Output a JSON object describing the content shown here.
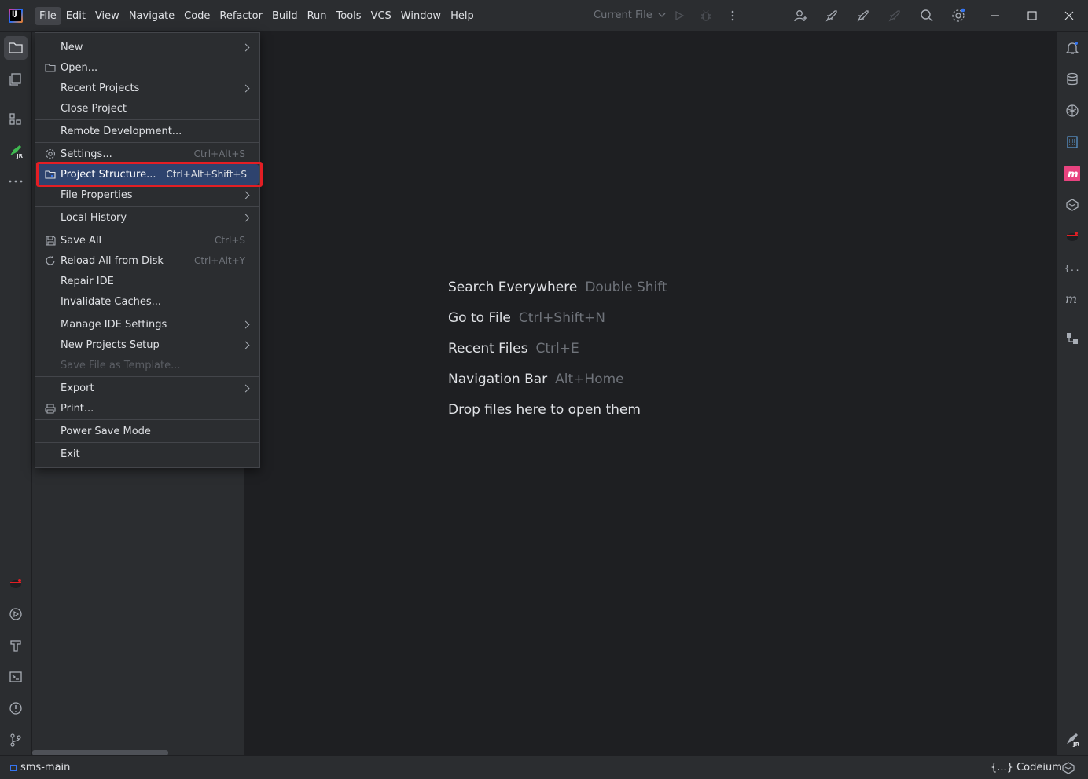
{
  "title_bar": {
    "logo_text": "IJ",
    "menus": [
      "File",
      "Edit",
      "View",
      "Navigate",
      "Code",
      "Refactor",
      "Build",
      "Run",
      "Tools",
      "VCS",
      "Window",
      "Help"
    ],
    "run_config": "Current File"
  },
  "file_menu": {
    "items": [
      {
        "label": "New",
        "shortcut": "",
        "submenu": true,
        "icon": ""
      },
      {
        "label": "Open...",
        "shortcut": "",
        "submenu": false,
        "icon": "folder-icon"
      },
      {
        "label": "Recent Projects",
        "shortcut": "",
        "submenu": true,
        "icon": ""
      },
      {
        "label": "Close Project",
        "shortcut": "",
        "submenu": false,
        "icon": ""
      },
      {
        "label": "Remote Development...",
        "shortcut": "",
        "submenu": false,
        "icon": ""
      },
      {
        "label": "Settings...",
        "shortcut": "Ctrl+Alt+S",
        "submenu": false,
        "icon": "gear-icon"
      },
      {
        "label": "Project Structure...",
        "shortcut": "Ctrl+Alt+Shift+S",
        "submenu": false,
        "icon": "project-structure-icon",
        "highlighted": true
      },
      {
        "label": "File Properties",
        "shortcut": "",
        "submenu": true,
        "icon": ""
      },
      {
        "label": "Local History",
        "shortcut": "",
        "submenu": true,
        "icon": ""
      },
      {
        "label": "Save All",
        "shortcut": "Ctrl+S",
        "submenu": false,
        "icon": "save-icon"
      },
      {
        "label": "Reload All from Disk",
        "shortcut": "Ctrl+Alt+Y",
        "submenu": false,
        "icon": "reload-icon"
      },
      {
        "label": "Repair IDE",
        "shortcut": "",
        "submenu": false,
        "icon": ""
      },
      {
        "label": "Invalidate Caches...",
        "shortcut": "",
        "submenu": false,
        "icon": ""
      },
      {
        "label": "Manage IDE Settings",
        "shortcut": "",
        "submenu": true,
        "icon": ""
      },
      {
        "label": "New Projects Setup",
        "shortcut": "",
        "submenu": true,
        "icon": ""
      },
      {
        "label": "Save File as Template...",
        "shortcut": "",
        "submenu": false,
        "icon": "",
        "disabled": true
      },
      {
        "label": "Export",
        "shortcut": "",
        "submenu": true,
        "icon": ""
      },
      {
        "label": "Print...",
        "shortcut": "",
        "submenu": false,
        "icon": "print-icon"
      },
      {
        "label": "Power Save Mode",
        "shortcut": "",
        "submenu": false,
        "icon": ""
      },
      {
        "label": "Exit",
        "shortcut": "",
        "submenu": false,
        "icon": ""
      }
    ]
  },
  "editor_hints": [
    {
      "label": "Search Everywhere",
      "key": "Double Shift"
    },
    {
      "label": "Go to File",
      "key": "Ctrl+Shift+N"
    },
    {
      "label": "Recent Files",
      "key": "Ctrl+E"
    },
    {
      "label": "Navigation Bar",
      "key": "Alt+Home"
    },
    {
      "label": "Drop files here to open them",
      "key": ""
    }
  ],
  "status_bar": {
    "project": "sms-main",
    "codeium": "{...} Codeium"
  },
  "colors": {
    "highlight": "#2e436e",
    "annotation_box": "#e31e24",
    "accent": "#3574f0"
  }
}
